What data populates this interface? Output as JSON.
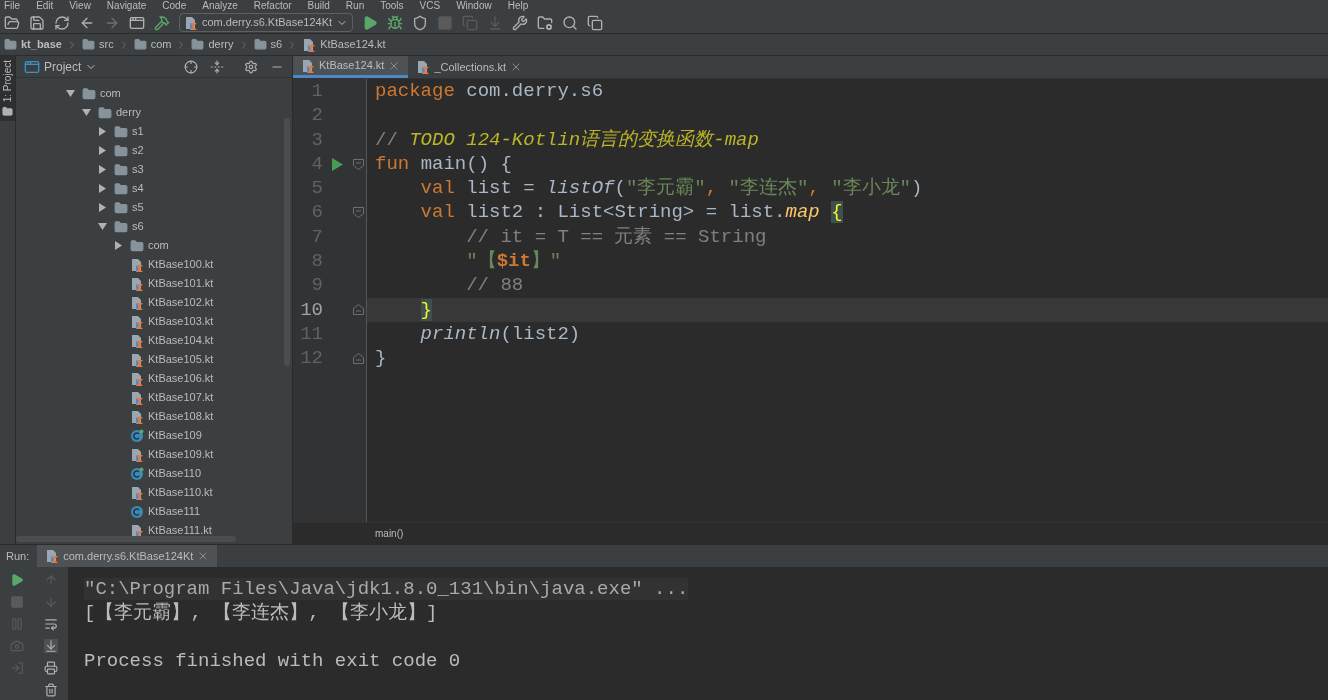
{
  "menu": [
    "File",
    "Edit",
    "View",
    "Navigate",
    "Code",
    "Analyze",
    "Refactor",
    "Build",
    "Run",
    "Tools",
    "VCS",
    "Window",
    "Help"
  ],
  "toolbar": {
    "run_config": "com.derry.s6.KtBase124Kt"
  },
  "breadcrumbs": [
    "kt_base",
    "src",
    "com",
    "derry",
    "s6",
    "KtBase124.kt"
  ],
  "side_strip": {
    "label": "1: Project"
  },
  "project_panel": {
    "title": "Project",
    "tree": [
      {
        "label": "com",
        "kind": "folder",
        "expanded": true,
        "children": [
          {
            "label": "derry",
            "kind": "folder",
            "expanded": true,
            "children": [
              {
                "label": "s1",
                "kind": "folder",
                "expanded": false
              },
              {
                "label": "s2",
                "kind": "folder",
                "expanded": false
              },
              {
                "label": "s3",
                "kind": "folder",
                "expanded": false
              },
              {
                "label": "s4",
                "kind": "folder",
                "expanded": false
              },
              {
                "label": "s5",
                "kind": "folder",
                "expanded": false
              },
              {
                "label": "s6",
                "kind": "folder",
                "expanded": true,
                "children": [
                  {
                    "label": "com",
                    "kind": "folder",
                    "expanded": false
                  },
                  {
                    "label": "KtBase100.kt",
                    "kind": "kotlin-file"
                  },
                  {
                    "label": "KtBase101.kt",
                    "kind": "kotlin-file"
                  },
                  {
                    "label": "KtBase102.kt",
                    "kind": "kotlin-file"
                  },
                  {
                    "label": "KtBase103.kt",
                    "kind": "kotlin-file"
                  },
                  {
                    "label": "KtBase104.kt",
                    "kind": "kotlin-file"
                  },
                  {
                    "label": "KtBase105.kt",
                    "kind": "kotlin-file"
                  },
                  {
                    "label": "KtBase106.kt",
                    "kind": "kotlin-file"
                  },
                  {
                    "label": "KtBase107.kt",
                    "kind": "kotlin-file"
                  },
                  {
                    "label": "KtBase108.kt",
                    "kind": "kotlin-file"
                  },
                  {
                    "label": "KtBase109",
                    "kind": "main-class"
                  },
                  {
                    "label": "KtBase109.kt",
                    "kind": "kotlin-file"
                  },
                  {
                    "label": "KtBase110",
                    "kind": "main-class"
                  },
                  {
                    "label": "KtBase110.kt",
                    "kind": "kotlin-file"
                  },
                  {
                    "label": "KtBase111",
                    "kind": "class"
                  },
                  {
                    "label": "KtBase111.kt",
                    "kind": "kotlin-file"
                  }
                ]
              }
            ]
          }
        ]
      }
    ]
  },
  "editor": {
    "tabs": [
      {
        "label": "KtBase124.kt",
        "selected": true
      },
      {
        "label": "_Collections.kt",
        "selected": false
      }
    ],
    "lines": [
      {
        "number": "1",
        "selected": false,
        "run": false,
        "fold_start": false,
        "fold_end": false,
        "tokens": [
          {
            "text": "package",
            "kind": "keyword"
          },
          {
            "text": " com.derry.s6",
            "kind": "plain"
          }
        ]
      },
      {
        "number": "2",
        "selected": false,
        "run": false,
        "fold_start": false,
        "fold_end": false
      },
      {
        "number": "3",
        "selected": false,
        "run": false,
        "fold_start": false,
        "fold_end": false,
        "tokens": [
          {
            "text": "// ",
            "kind": "comment"
          },
          {
            "text": "TODO 124-Kotlin语言的变换函数-map",
            "kind": "todo"
          }
        ]
      },
      {
        "number": "4",
        "selected": false,
        "run": true,
        "fold_start": true,
        "fold_end": false,
        "tokens": [
          {
            "text": "fun",
            "kind": "keyword"
          },
          {
            "text": " main() {",
            "kind": "plain"
          }
        ]
      },
      {
        "number": "5",
        "selected": false,
        "run": false,
        "fold_start": false,
        "fold_end": false,
        "tokens": [
          {
            "text": "    val",
            "kind": "keyword"
          },
          {
            "text": " list = ",
            "kind": "plain"
          },
          {
            "text": "listOf",
            "kind": "call"
          },
          {
            "text": "(",
            "kind": "plain"
          },
          {
            "text": "\"李元霸\"",
            "kind": "string"
          },
          {
            "text": ", ",
            "kind": "keyword"
          },
          {
            "text": "\"李连杰\"",
            "kind": "string"
          },
          {
            "text": ", ",
            "kind": "keyword"
          },
          {
            "text": "\"李小龙\"",
            "kind": "string"
          },
          {
            "text": ")",
            "kind": "plain"
          }
        ]
      },
      {
        "number": "6",
        "selected": false,
        "run": false,
        "fold_start": true,
        "fold_end": false,
        "tokens": [
          {
            "text": "    val",
            "kind": "keyword"
          },
          {
            "text": " list2 : List<String> = list.",
            "kind": "plain"
          },
          {
            "text": "map",
            "kind": "extension"
          },
          {
            "text": " {",
            "kind": "brace-match"
          }
        ]
      },
      {
        "number": "7",
        "selected": false,
        "run": false,
        "fold_start": false,
        "fold_end": false,
        "tokens": [
          {
            "text": "        // it = T == 元素 == String",
            "kind": "comment"
          }
        ]
      },
      {
        "number": "8",
        "selected": false,
        "run": false,
        "fold_start": false,
        "fold_end": false,
        "tokens": [
          {
            "text": "        \"【",
            "kind": "string"
          },
          {
            "text": "$it",
            "kind": "template"
          },
          {
            "text": "】\"",
            "kind": "string"
          }
        ]
      },
      {
        "number": "9",
        "selected": false,
        "run": false,
        "fold_start": false,
        "fold_end": false,
        "tokens": [
          {
            "text": "        // 88",
            "kind": "comment"
          }
        ]
      },
      {
        "number": "10",
        "selected": true,
        "run": false,
        "fold_start": false,
        "fold_end": true,
        "tokens": [
          {
            "text": "    }",
            "kind": "brace-match"
          }
        ]
      },
      {
        "number": "11",
        "selected": false,
        "run": false,
        "fold_start": false,
        "fold_end": false,
        "tokens": [
          {
            "text": "    println",
            "kind": "call"
          },
          {
            "text": "(list2)",
            "kind": "plain"
          }
        ]
      },
      {
        "number": "12",
        "selected": false,
        "run": false,
        "fold_start": false,
        "fold_end": true,
        "tokens": [
          {
            "text": "}",
            "kind": "plain"
          }
        ]
      }
    ],
    "breadcrumb": "main()"
  },
  "run_panel": {
    "label": "Run:",
    "tab": "com.derry.s6.KtBase124Kt",
    "output": [
      {
        "text": "\"C:\\Program Files\\Java\\jdk1.8.0_131\\bin\\java.exe\" ...",
        "kind": "command",
        "blank_before": false
      },
      {
        "text": "[【李元霸】, 【李连杰】, 【李小龙】]",
        "kind": "stdout",
        "blank_before": false
      },
      {
        "text": "Process finished with exit code 0",
        "kind": "stdout",
        "blank_before": true
      }
    ]
  }
}
